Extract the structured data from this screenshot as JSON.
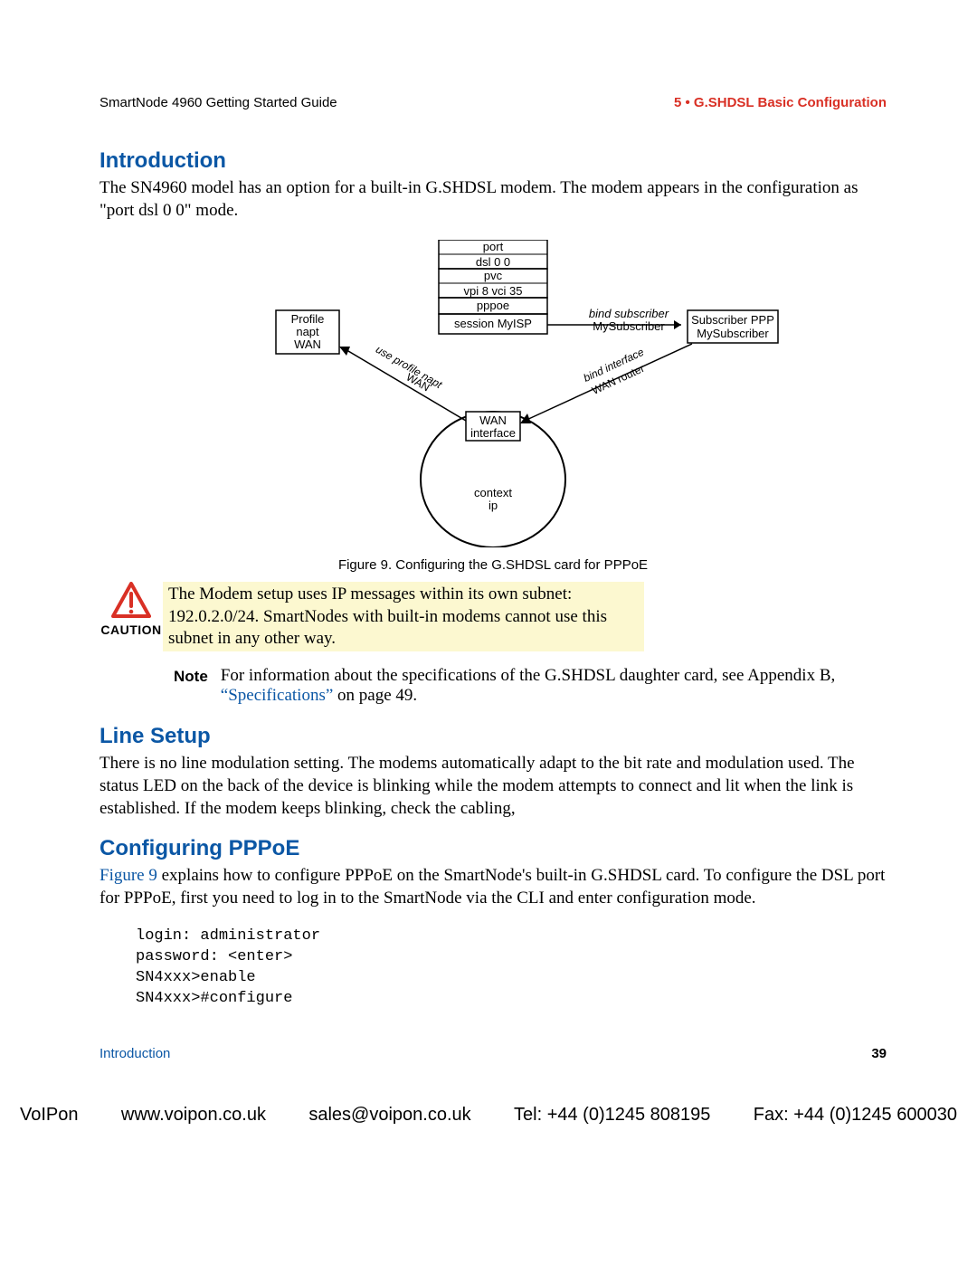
{
  "header": {
    "left": "SmartNode 4960 Getting Started Guide",
    "right": "5 • G.SHDSL Basic Configuration"
  },
  "sections": {
    "intro_heading": "Introduction",
    "intro_body": "The SN4960 model has an option for a built-in G.SHDSL modem. The modem appears in the configuration as \"port dsl 0 0\" mode.",
    "line_heading": "Line Setup",
    "line_body": "There is no line modulation setting. The modems automatically adapt to the bit rate and modulation used. The status LED on the back of the device is blinking while the modem attempts to connect and lit when the link is established. If the modem keeps blinking, check the cabling,",
    "pppoe_heading": "Configuring PPPoE",
    "pppoe_body_pre": " explains how to configure PPPoE on the SmartNode's built-in G.SHDSL card. To configure the DSL port for PPPoE, first you need to log in to the SmartNode via the CLI and enter configuration mode.",
    "pppoe_link": "Figure 9"
  },
  "figure": {
    "caption": "Figure 9. Configuring the G.SHDSL card for PPPoE",
    "blocks": {
      "port_top": "port",
      "port_bottom": "dsl   0   0",
      "pvc_top": "pvc",
      "pvc_bottom": "vpi  8      vci  35",
      "pppoe": "pppoe",
      "session": "session MyISP",
      "profile_l1": "Profile",
      "profile_l2": "napt",
      "profile_l3": "WAN",
      "sub_l1": "Subscriber PPP",
      "sub_l2": "MySubscriber",
      "bind_sub_l1": "bind subscriber",
      "bind_sub_l2": "MySubscriber",
      "use_profile_l1": "use profile napt",
      "use_profile_l2": "WAN",
      "bind_if_l1": "bind interface",
      "bind_if_l2": "WAN router",
      "wan_l1": "WAN",
      "wan_l2": "interface",
      "ctx_l1": "context",
      "ctx_l2": "ip"
    }
  },
  "caution": {
    "label": "CAUTION",
    "text": "The Modem setup uses IP messages within its own subnet: 192.0.2.0/24. SmartNodes with built-in modems cannot use this subnet in any other way."
  },
  "note": {
    "label": "Note",
    "pre": "For information about the specifications of the G.SHDSL daughter card, see Appendix B, ",
    "link": "“Specifications”",
    "post": " on page 49."
  },
  "code": "login: administrator\npassword: <enter>\nSN4xxx>enable\nSN4xxx>#configure",
  "footer": {
    "left": "Introduction",
    "right": "39"
  },
  "contact": {
    "company": "VoIPon",
    "url": "www.voipon.co.uk",
    "email": "sales@voipon.co.uk",
    "tel": "Tel: +44 (0)1245 808195",
    "fax": "Fax: +44 (0)1245 600030"
  }
}
